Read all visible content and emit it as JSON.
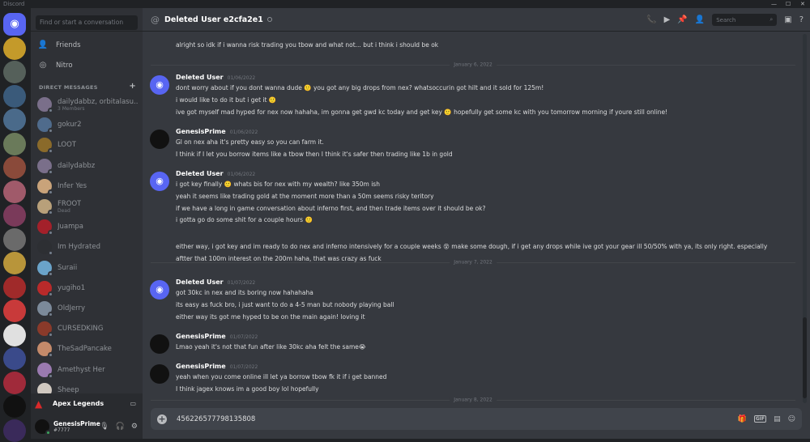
{
  "app": {
    "title": "Discord",
    "window_controls": [
      "—",
      "☐",
      "✕"
    ]
  },
  "sidebar": {
    "search_placeholder": "Find or start a conversation",
    "nav": [
      {
        "label": "Friends",
        "icon": "friends-icon"
      },
      {
        "label": "Nitro",
        "icon": "nitro-icon"
      }
    ],
    "dm_header": "DIRECT MESSAGES",
    "dm_add": "+",
    "dms": [
      {
        "name": "dailydabbz, orbitalasu...",
        "sub": "3 Members",
        "color": "#7a6f8a",
        "online": false
      },
      {
        "name": "gokur2",
        "sub": "",
        "color": "#4f6b8c",
        "online": false
      },
      {
        "name": "LOOT",
        "sub": "",
        "color": "#8a6a2a",
        "online": false
      },
      {
        "name": "dailydabbz",
        "sub": "",
        "color": "#7a6f8a",
        "online": false
      },
      {
        "name": "Infer Yes",
        "sub": "",
        "color": "#c9a37a",
        "online": false
      },
      {
        "name": "FROOT",
        "sub": "Dead",
        "color": "#b8a07a",
        "online": false
      },
      {
        "name": "Juampa",
        "sub": "",
        "color": "#a3202a",
        "online": false
      },
      {
        "name": "Im Hydrated",
        "sub": "",
        "color": "#2d2f33",
        "online": false
      },
      {
        "name": "Suraii",
        "sub": "",
        "color": "#6aa3c9",
        "online": false
      },
      {
        "name": "yugiho1",
        "sub": "",
        "color": "#b92a2a",
        "online": false
      },
      {
        "name": "OldJerry",
        "sub": "",
        "color": "#7c8a9a",
        "online": false
      },
      {
        "name": "CURSEDKING",
        "sub": "",
        "color": "#8a3a2a",
        "online": false
      },
      {
        "name": "TheSadPancake",
        "sub": "",
        "color": "#c48a6a",
        "online": false
      },
      {
        "name": "Amethyst Her",
        "sub": "",
        "color": "#9a7ab0",
        "online": false
      },
      {
        "name": "Sheep",
        "sub": "",
        "color": "#d0c8c0",
        "online": false
      }
    ],
    "game": {
      "label": "Apex Legends"
    },
    "user": {
      "name": "GenesisPrime",
      "tag": "#7777"
    }
  },
  "servers": [
    {
      "color": "#5865f2"
    },
    {
      "color": "#c49a2a"
    },
    {
      "color": "#55605a"
    },
    {
      "color": "#3a5a7a"
    },
    {
      "color": "#4a6a8a"
    },
    {
      "color": "#6a7a5a"
    },
    {
      "color": "#8a4a3a"
    },
    {
      "color": "#a05a6a"
    },
    {
      "color": "#7a3a5a"
    },
    {
      "color": "#6a6a6a"
    },
    {
      "color": "#b8953a"
    },
    {
      "color": "#a02a2a"
    },
    {
      "color": "#c83a3a"
    },
    {
      "color": "#e0e0e0"
    },
    {
      "color": "#3a4a8a"
    },
    {
      "color": "#a02a3a"
    },
    {
      "color": "#111111"
    },
    {
      "color": "#3a2a5a"
    }
  ],
  "header": {
    "title": "Deleted User e2cfa2e1",
    "search_placeholder": "Search"
  },
  "messages": {
    "top_line": "alright so idk if i wanna risk trading you tbow and what not... but i think i should be ok",
    "date1": "January 6, 2022",
    "groups": [
      {
        "author": "Deleted User",
        "ts": "01/06/2022",
        "av": "discord",
        "lines": [
          "dont worry about if you dont wanna dude 🙂 you got any big drops from nex? whatsoccurin got hilt and it sold for 125m!",
          "i would like to do it but i get it 🙂",
          "ive got myself mad hyped for nex now hahaha, im gonna get gwd kc today and get key 🙂 hopefully get some kc with you tomorrow morning if youre still online!"
        ]
      },
      {
        "author": "GenesisPrime",
        "ts": "01/06/2022",
        "av": "gp",
        "lines": [
          "Gl on nex aha it's pretty easy so you can farm it.",
          "I think if I let you borrow items like a tbow then I think it's safer then trading like 1b in gold"
        ]
      },
      {
        "author": "Deleted User",
        "ts": "01/06/2022",
        "av": "discord",
        "lines": [
          "i got key finally 🙂 whats bis for nex with my wealth? like 350m ish",
          "yeah it seems like trading gold at the moment more than a 50m seems risky teritory",
          "if we have a long in game conversation about inferno first, and then trade items over it should be ok?",
          "i gotta go do some shit for a couple hours 🙂",
          "",
          "either way, i got key and im ready to do nex and inferno intensively for a couple weeks 😵 make some dough,   if i get any drops while ive got your gear ill 50/50% with ya, its only right. especially",
          "aftter that 100m interest on the 200m haha, that was crazy as fuck"
        ]
      }
    ],
    "date2": "January 7, 2022",
    "groups2": [
      {
        "author": "Deleted User",
        "ts": "01/07/2022",
        "av": "discord",
        "lines": [
          "got 30kc in nex and its boring now hahahaha",
          "its easy as fuck bro, i just want to do a 4-5 man but nobody playing ball",
          "either way its got me hyped to be on the main again! loving it"
        ]
      },
      {
        "author": "GenesisPrime",
        "ts": "01/07/2022",
        "av": "gp",
        "lines": [
          "Lmao yeah it's not that fun after like 30kc aha felt the same😭"
        ]
      },
      {
        "author": "GenesisPrime",
        "ts": "01/07/2022",
        "av": "gp",
        "lines": [
          "yeah when you come online ill let ya borrow tbow fk it if i get banned",
          "I think jagex knows im a good boy lol hopefully"
        ]
      }
    ],
    "date3": "January 8, 2022"
  },
  "composer": {
    "value": "456226577798135808",
    "gif": "GIF"
  }
}
